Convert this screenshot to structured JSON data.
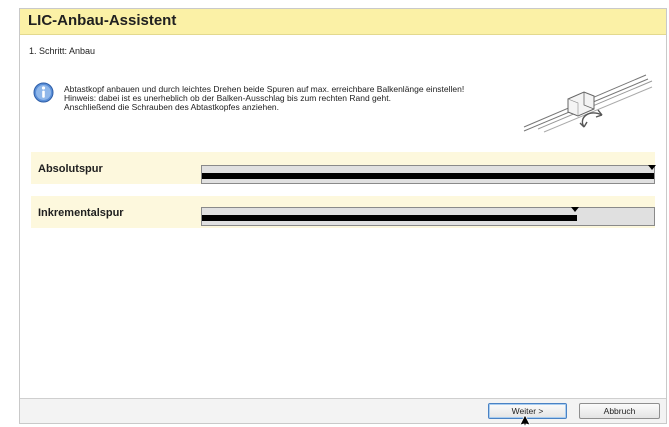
{
  "window": {
    "title": "LIC-Anbau-Assistent"
  },
  "step": {
    "label": "1. Schritt: Anbau"
  },
  "instructions": {
    "line1": "Abtastkopf anbauen und durch leichtes Drehen beide Spuren auf max. erreichbare Balkenlänge einstellen!",
    "line2": "Hinweis: dabei ist es unerheblich ob der Balken-Ausschlag bis zum rechten Rand geht.",
    "line3": "Anschließend die Schrauben des Abtastkopfes anziehen.",
    "icon": "info-icon"
  },
  "tracks": [
    {
      "label": "Absolutspur",
      "fill_fraction": 1.0,
      "marker_fraction": 0.995
    },
    {
      "label": "Inkrementalspur",
      "fill_fraction": 0.83,
      "marker_fraction": 0.826
    }
  ],
  "buttons": {
    "next": "Weiter >",
    "cancel": "Abbruch"
  },
  "colors": {
    "title_bar": "#fbf1a6",
    "track_band": "#fdf8dd",
    "bar_fill": "#000000"
  }
}
